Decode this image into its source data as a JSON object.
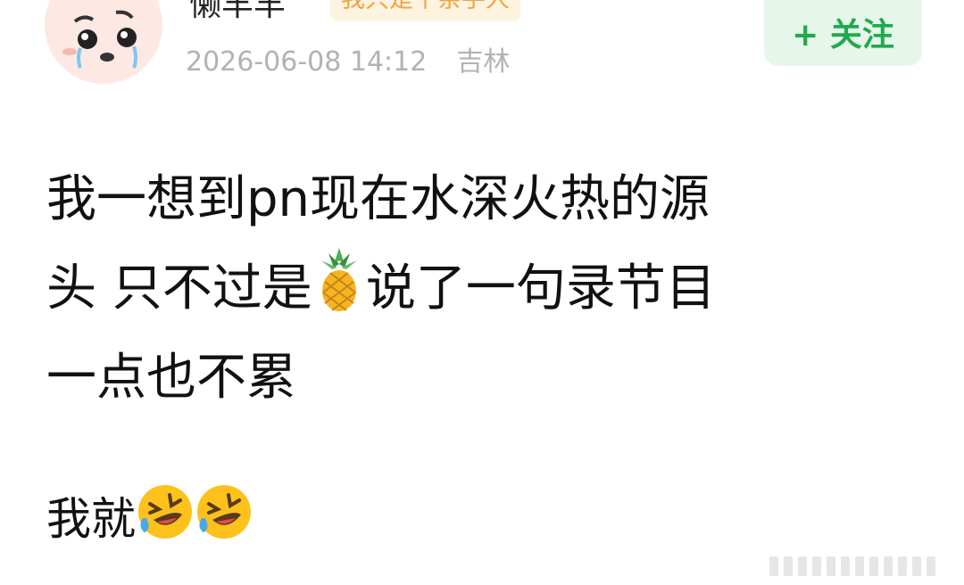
{
  "header": {
    "username": "懒羊羊",
    "badge": "我只是个亲手人",
    "timestamp": "2026-06-08 14:12",
    "location": "吉林",
    "follow_label": "+ 关注"
  },
  "post": {
    "line1": "我一想到pn现在水深火热的源",
    "line2_before_emoji": "头 只不过是",
    "line2_emoji": "pineapple-icon",
    "line2_after_emoji": "说了一句录节目",
    "line3": "一点也不累",
    "tail_text": "我就",
    "tail_emojis": [
      "rolling-laughing-icon",
      "rolling-laughing-icon"
    ]
  },
  "colors": {
    "accent_green": "#1faa4d",
    "follow_bg": "#e6f6ea",
    "badge_text": "#f0a43c",
    "badge_bg": "#fdf3df",
    "meta_gray": "#b2b2b2"
  }
}
